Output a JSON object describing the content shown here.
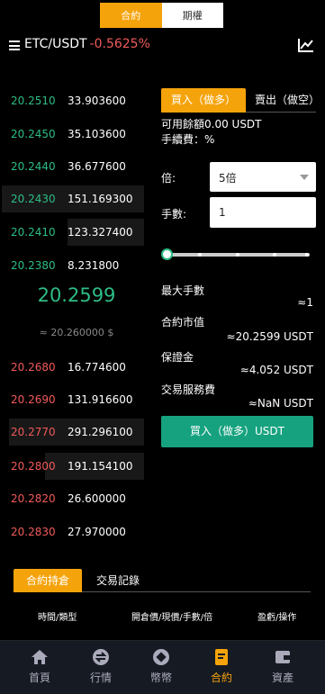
{
  "top_tabs": [
    "合約",
    "期權"
  ],
  "header": {
    "pair": "ETC/USDT",
    "change": "-0.5625%"
  },
  "order_book": {
    "bids": [
      {
        "price": "20.2510",
        "qty": "33.903600"
      },
      {
        "price": "20.2450",
        "qty": "35.103600"
      },
      {
        "price": "20.2440",
        "qty": "36.677600"
      },
      {
        "price": "20.2430",
        "qty": "151.169300"
      },
      {
        "price": "20.2410",
        "qty": "123.327400"
      },
      {
        "price": "20.2380",
        "qty": "8.231800"
      }
    ],
    "last_price": "20.2599",
    "reference": "≈ 20.260000 $",
    "asks": [
      {
        "price": "20.2680",
        "qty": "16.774600"
      },
      {
        "price": "20.2690",
        "qty": "131.916600"
      },
      {
        "price": "20.2770",
        "qty": "291.296100"
      },
      {
        "price": "20.2800",
        "qty": "191.154100"
      },
      {
        "price": "20.2820",
        "qty": "26.600000"
      },
      {
        "price": "20.2830",
        "qty": "27.970000"
      }
    ]
  },
  "trade": {
    "buy_tab": "買入（做多）",
    "sell_tab": "賣出（做空）",
    "available": "可用餘額0.00 USDT",
    "fee": "手續費：%",
    "leverage_label": "倍:",
    "leverage_value": "5倍",
    "lots_label": "手數:",
    "lots_value": "1",
    "slider_fraction": 0,
    "max_lots_label": "最大手數",
    "max_lots_value": "≈1",
    "contract_value_label": "合約市值",
    "contract_value": "≈20.2599 USDT",
    "margin_label": "保證金",
    "margin_value": "≈4.052 USDT",
    "service_fee_label": "交易服務費",
    "service_fee_value": "≈NaN USDT",
    "submit": "買入（做多）USDT"
  },
  "positions": {
    "tabs": [
      "合約持倉",
      "交易記錄"
    ],
    "columns": [
      "時間/類型",
      "開倉價/現價/手數/倍",
      "盈虧/操作"
    ]
  },
  "bottom_nav": [
    "首頁",
    "行情",
    "幣幣",
    "合約",
    "資產"
  ],
  "colors": {
    "accent": "#f5a30b",
    "up": "#2ebd85",
    "down": "#f05a5a",
    "button": "#17a27f"
  }
}
